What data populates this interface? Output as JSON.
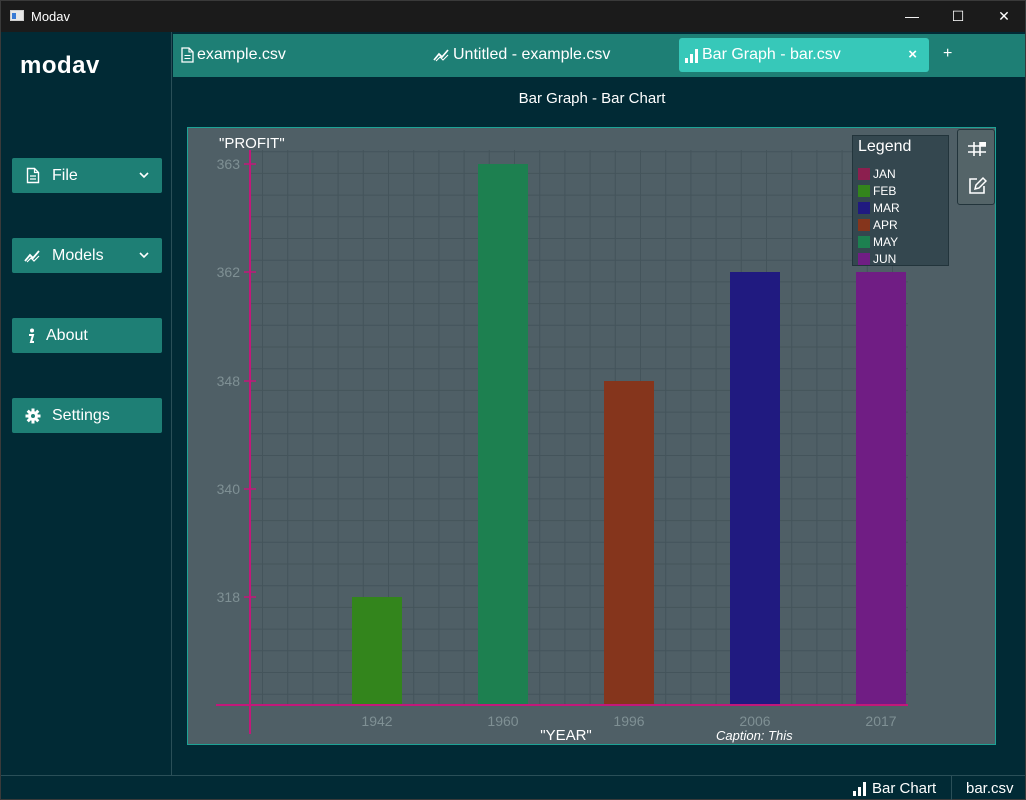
{
  "window": {
    "title": "Modav",
    "minimize_symbol": "—",
    "maximize_symbol": "☐",
    "close_symbol": "✕"
  },
  "sidebar": {
    "logo": "modav",
    "items": [
      {
        "label": "File",
        "icon": "file-icon",
        "has_dropdown": true
      },
      {
        "label": "Models",
        "icon": "chart-line-icon",
        "has_dropdown": true
      },
      {
        "label": "About",
        "icon": "info-icon",
        "has_dropdown": false
      },
      {
        "label": "Settings",
        "icon": "gear-icon",
        "has_dropdown": false
      }
    ]
  },
  "tabs": {
    "items": [
      {
        "label": "example.csv",
        "icon": "file-icon",
        "active": false
      },
      {
        "label": "Untitled - example.csv",
        "icon": "chart-line-icon",
        "active": false
      },
      {
        "label": "Bar Graph - bar.csv",
        "icon": "bar-chart-icon",
        "active": true
      }
    ],
    "close_symbol": "×",
    "add_symbol": "+"
  },
  "content": {
    "heading": "Bar Graph - Bar Chart"
  },
  "colors": {
    "background": "#012a35",
    "accent": "#1e7f75",
    "active_tab": "#37c8b9",
    "chart_background": "#4f5f66",
    "axis": "#c2187a",
    "tick_label": "#7f9094"
  },
  "chart_data": {
    "type": "bar",
    "x_axis_label": "\"YEAR\"",
    "y_axis_label": "\"PROFIT\"",
    "caption": "Caption: This",
    "categories": [
      "1942",
      "1960",
      "1996",
      "2006",
      "2017"
    ],
    "y_ticks": [
      "318",
      "340",
      "348",
      "362",
      "363"
    ],
    "grid": true,
    "legend": {
      "title": "Legend",
      "placement": "top-right",
      "items": [
        {
          "label": "JAN",
          "color": "#8c1f4f"
        },
        {
          "label": "FEB",
          "color": "#33851c"
        },
        {
          "label": "MAR",
          "color": "#201a80"
        },
        {
          "label": "APR",
          "color": "#85351c"
        },
        {
          "label": "MAY",
          "color": "#1d8050"
        },
        {
          "label": "JUN",
          "color": "#701d84"
        }
      ]
    },
    "bars": [
      {
        "category": "1942",
        "value": 318,
        "series": "FEB",
        "color": "#33851c"
      },
      {
        "category": "1960",
        "value": 363,
        "series": "MAY",
        "color": "#1d8050"
      },
      {
        "category": "1996",
        "value": 348,
        "series": "APR",
        "color": "#85351c"
      },
      {
        "category": "2006",
        "value": 362,
        "series": "MAR",
        "color": "#201a80"
      },
      {
        "category": "2017",
        "value": 362,
        "series": "JUN",
        "color": "#701d84"
      }
    ]
  },
  "chart_tools": [
    {
      "name": "toggle-grid-button",
      "icon": "grid-icon"
    },
    {
      "name": "edit-chart-button",
      "icon": "edit-icon"
    }
  ],
  "statusbar": {
    "chart_type": "Bar Chart",
    "file": "bar.csv"
  }
}
